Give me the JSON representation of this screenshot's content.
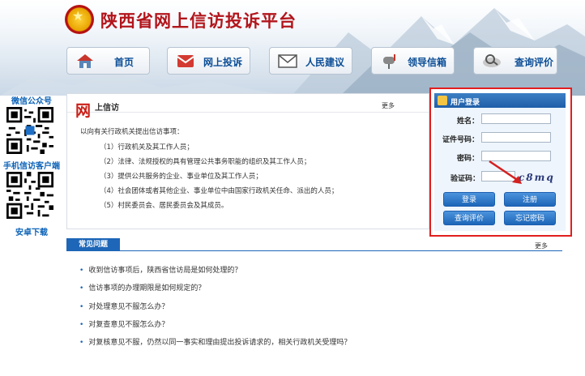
{
  "header": {
    "site_title": "陕西省网上信访投诉平台",
    "nav": [
      {
        "label": "首页",
        "icon": "home-icon"
      },
      {
        "label": "网上投诉",
        "icon": "mail-icon"
      },
      {
        "label": "人民建议",
        "icon": "envelope-icon"
      },
      {
        "label": "领导信箱",
        "icon": "mailbox-icon"
      },
      {
        "label": "查询评价",
        "icon": "search-icon"
      }
    ]
  },
  "sidebar": {
    "wechat_label": "微信公众号",
    "app_label": "手机信访客户端",
    "android_label": "安卓下载"
  },
  "petition": {
    "logo_char": "网",
    "title": "上信访",
    "more": "更多",
    "intro": "以向有关行政机关提出信访事项：",
    "items": [
      "（1）行政机关及其工作人员；",
      "（2）法律、法规授权的具有管理公共事务职能的组织及其工作人员；",
      "（3）提供公共服务的企业、事业单位及其工作人员；",
      "（4）社会团体或者其他企业、事业单位中由国家行政机关任命、派出的人员；",
      "（5）村民委员会、居民委员会及其成员。"
    ]
  },
  "login": {
    "title": "用户登录",
    "name_label": "姓名：",
    "id_label": "证件号码：",
    "password_label": "密码：",
    "captcha_label": "验证码：",
    "captcha_text": "c8mq",
    "login_button": "登录",
    "register_button": "注册",
    "query_button": "查询评价",
    "forgot_button": "忘记密码"
  },
  "faq": {
    "title": "常见问题",
    "more": "更多",
    "items": [
      "收到信访事项后，陕西省信访局是如何处理的？",
      "信访事项的办理期限是如何规定的？",
      "对处理意见不服怎么办？",
      "对复查意见不服怎么办？",
      "对复核意见不服，仍然以同一事实和理由提出投诉请求的，相关行政机关受理吗？"
    ]
  },
  "colors": {
    "brand_red": "#b2151b",
    "nav_blue": "#0b4d96",
    "button_blue": "#1d66b8",
    "highlight_red": "#e21e1e"
  }
}
